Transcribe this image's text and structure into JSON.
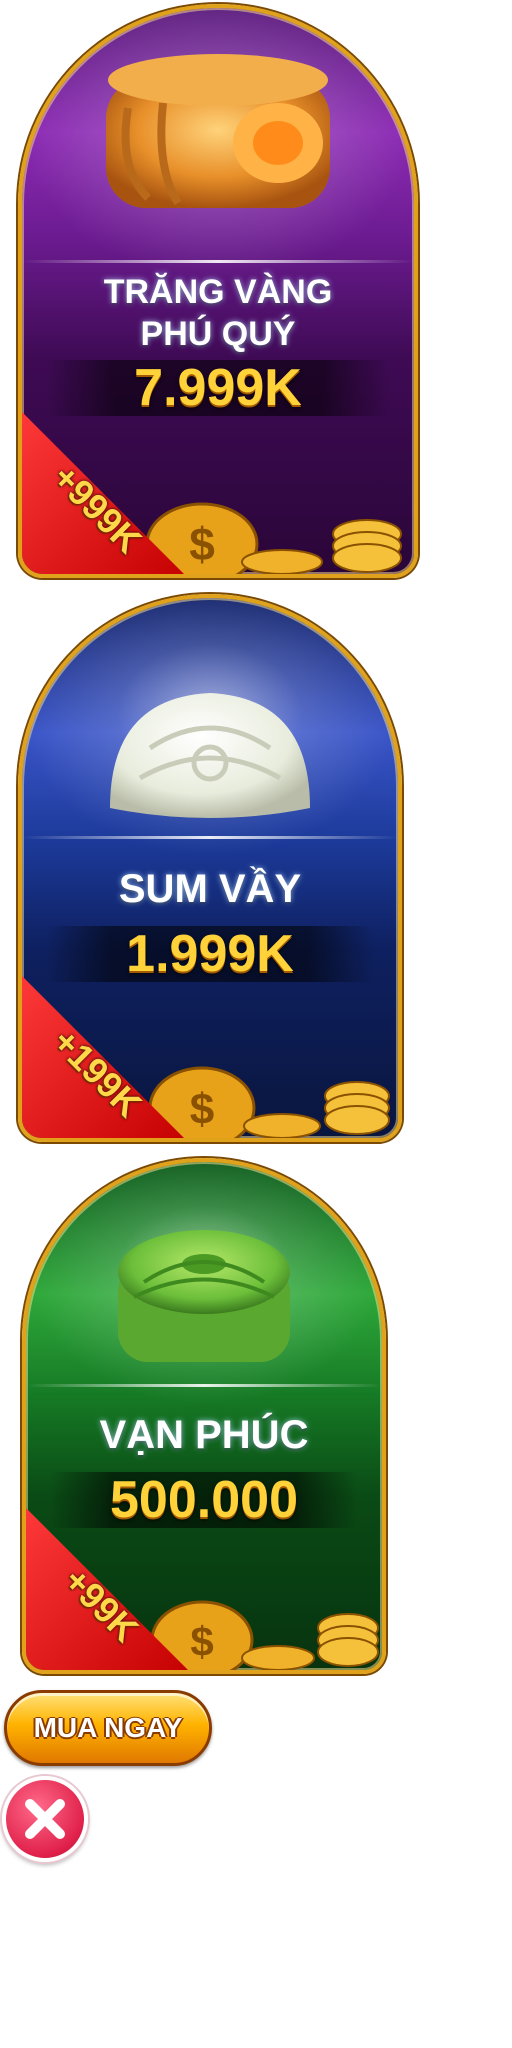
{
  "packages": [
    {
      "title_line1": "TRĂNG VÀNG",
      "title_line2": "PHÚ QUÝ",
      "price": "7.999K",
      "bonus": "+999K"
    },
    {
      "title_line1": "SUM VẦY",
      "price": "1.999K",
      "bonus": "+199K"
    },
    {
      "title_line1": "VẠN PHÚC",
      "price": "500.000",
      "bonus": "+99K"
    }
  ],
  "buy_button": {
    "label": "MUA NGAY"
  },
  "icons": {
    "mooncake_gold": "mooncake-icon",
    "mooncake_white": "snowskin-mooncake-icon",
    "mooncake_green": "green-mooncake-icon",
    "coin": "gold-coin-icon",
    "close": "close-icon"
  },
  "colors": {
    "gold_frame": "#e0a21a",
    "price_gold": "#ffd23a",
    "ribbon_red": "#d40000",
    "close_pink": "#e0204a"
  }
}
